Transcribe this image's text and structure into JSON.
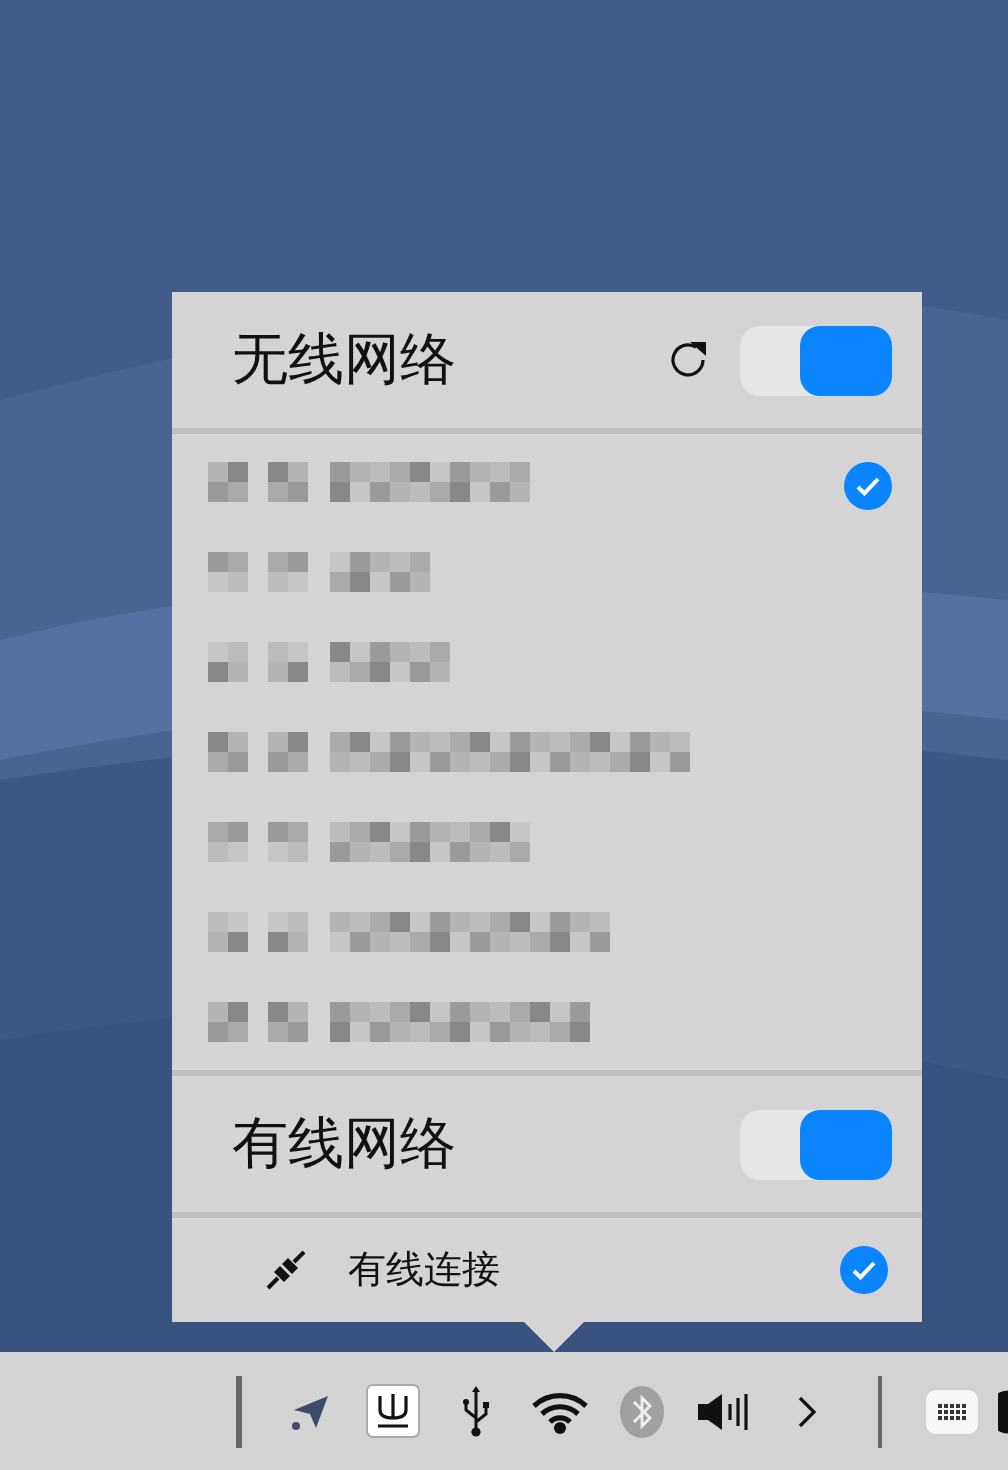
{
  "wireless": {
    "title": "无线网络",
    "on": true,
    "networks": [
      {
        "kind": "redacted",
        "connected": true
      },
      {
        "kind": "redacted",
        "connected": false
      },
      {
        "kind": "redacted",
        "connected": false
      },
      {
        "kind": "redacted",
        "connected": false
      },
      {
        "kind": "redacted",
        "connected": false
      },
      {
        "kind": "redacted",
        "connected": false
      },
      {
        "kind": "redacted",
        "connected": false
      }
    ]
  },
  "wired": {
    "title": "有线网络",
    "on": true,
    "connections": [
      {
        "label": "有线连接",
        "connected": true
      }
    ]
  },
  "tray": [
    {
      "kind": "location"
    },
    {
      "kind": "input"
    },
    {
      "kind": "usb"
    },
    {
      "kind": "wifi"
    },
    {
      "kind": "bluetooth",
      "on": false
    },
    {
      "kind": "volume"
    },
    {
      "kind": "more"
    },
    {
      "kind": "separator"
    },
    {
      "kind": "keyboard"
    },
    {
      "kind": "partial"
    }
  ]
}
